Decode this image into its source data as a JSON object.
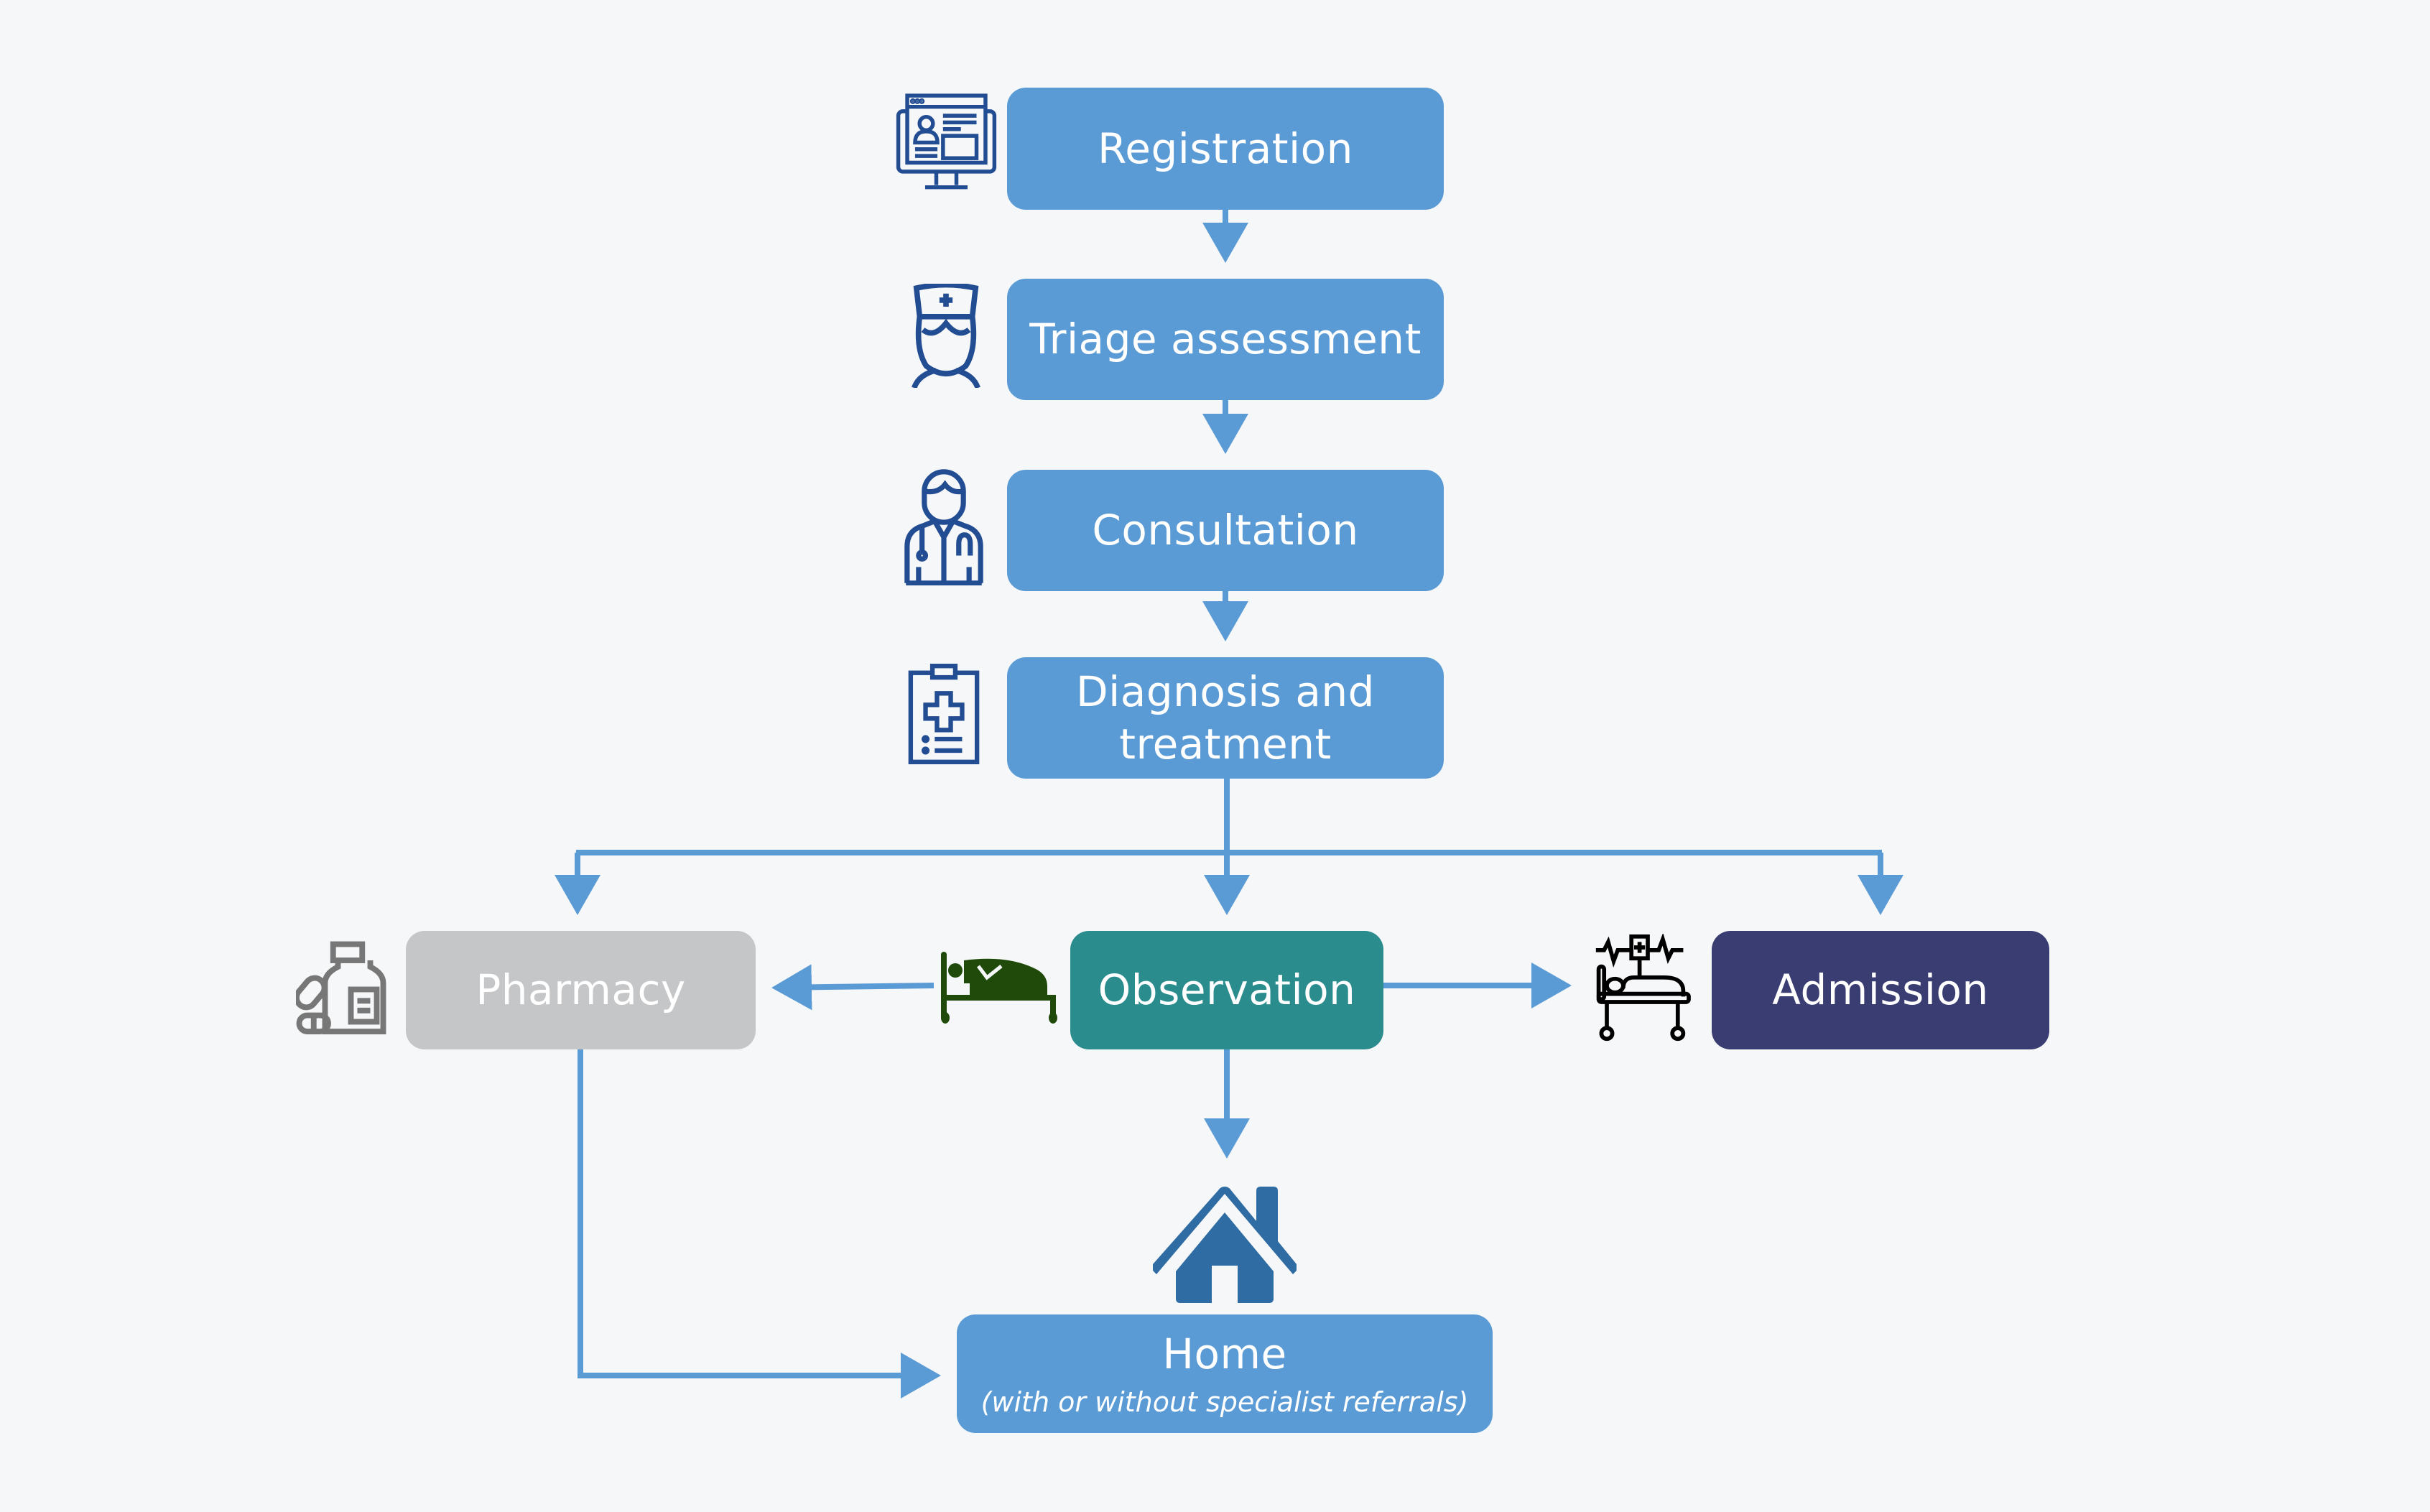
{
  "colors": {
    "background": "#f6f7f8",
    "primary_step": "#5b9bd5",
    "pharmacy": "#c5c6c8",
    "observation": "#2b8c8e",
    "admission": "#3a3d72",
    "connector": "#5b9bd5",
    "icon_blue": "#234d93",
    "icon_gray": "#777777",
    "icon_green": "#1f4a0a",
    "icon_black": "#000000",
    "home_icon": "#2f6ca3"
  },
  "nodes": {
    "registration": {
      "label": "Registration",
      "icon": "computer-id-card-icon"
    },
    "triage": {
      "label": "Triage assessment",
      "icon": "nurse-icon"
    },
    "consultation": {
      "label": "Consultation",
      "icon": "doctor-icon"
    },
    "diagnosis": {
      "label": "Diagnosis and treatment",
      "icon": "clipboard-medical-icon"
    },
    "pharmacy": {
      "label": "Pharmacy",
      "icon": "medicine-bottle-icon"
    },
    "observation": {
      "label": "Observation",
      "icon": "patient-in-bed-icon"
    },
    "admission": {
      "label": "Admission",
      "icon": "hospital-bed-monitor-icon"
    },
    "home": {
      "label": "Home",
      "sublabel": "(with or without specialist referrals)",
      "icon": "house-icon"
    }
  },
  "edges": [
    {
      "from": "Registration",
      "to": "Triage assessment"
    },
    {
      "from": "Triage assessment",
      "to": "Consultation"
    },
    {
      "from": "Consultation",
      "to": "Diagnosis and treatment"
    },
    {
      "from": "Diagnosis and treatment",
      "to": "Pharmacy"
    },
    {
      "from": "Diagnosis and treatment",
      "to": "Observation"
    },
    {
      "from": "Diagnosis and treatment",
      "to": "Admission"
    },
    {
      "from": "Observation",
      "to": "Pharmacy"
    },
    {
      "from": "Observation",
      "to": "Admission"
    },
    {
      "from": "Observation",
      "to": "Home"
    },
    {
      "from": "Pharmacy",
      "to": "Home"
    }
  ]
}
